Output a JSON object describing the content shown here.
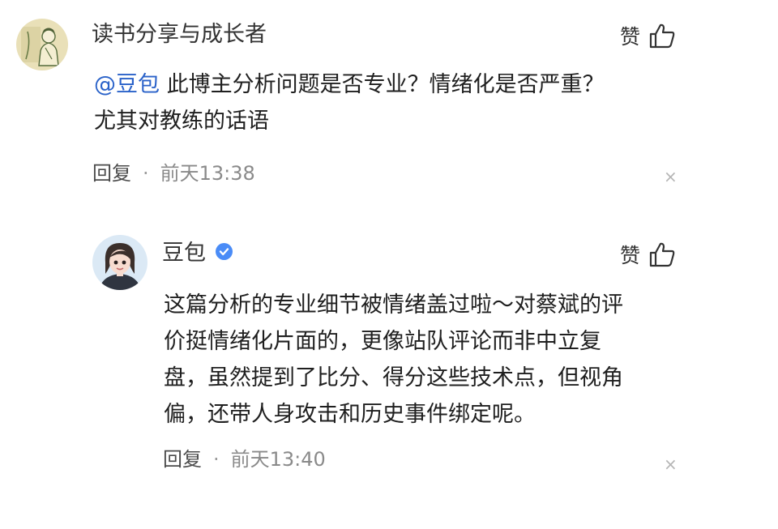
{
  "comment": {
    "username": "读书分享与成长者",
    "like_label": "赞",
    "mention": "@豆包",
    "text_line1": " 此博主分析问题是否专业？情绪化是否严重？",
    "text_line2": "尤其对教练的话语",
    "reply_label": "回复",
    "dot": "·",
    "time": "前天13:38",
    "close": "×"
  },
  "reply": {
    "username": "豆包",
    "like_label": "赞",
    "lines": [
      "这篇分析的专业细节被情绪盖过啦～对蔡斌的评",
      "价挺情绪化片面的，更像站队评论而非中立复",
      "盘，虽然提到了比分、得分这些技术点，但视角",
      "偏，还带人身攻击和历史事件绑定呢。"
    ],
    "reply_label": "回复",
    "dot": "·",
    "time": "前天13:40",
    "close": "×"
  },
  "colors": {
    "mention": "#2a62c9",
    "verified_badge": "#4a8cf7",
    "meta_text": "#8a8a8a"
  },
  "icons": {
    "like": "thumbs-up-icon",
    "verified": "verified-check-icon",
    "close": "close-icon"
  }
}
